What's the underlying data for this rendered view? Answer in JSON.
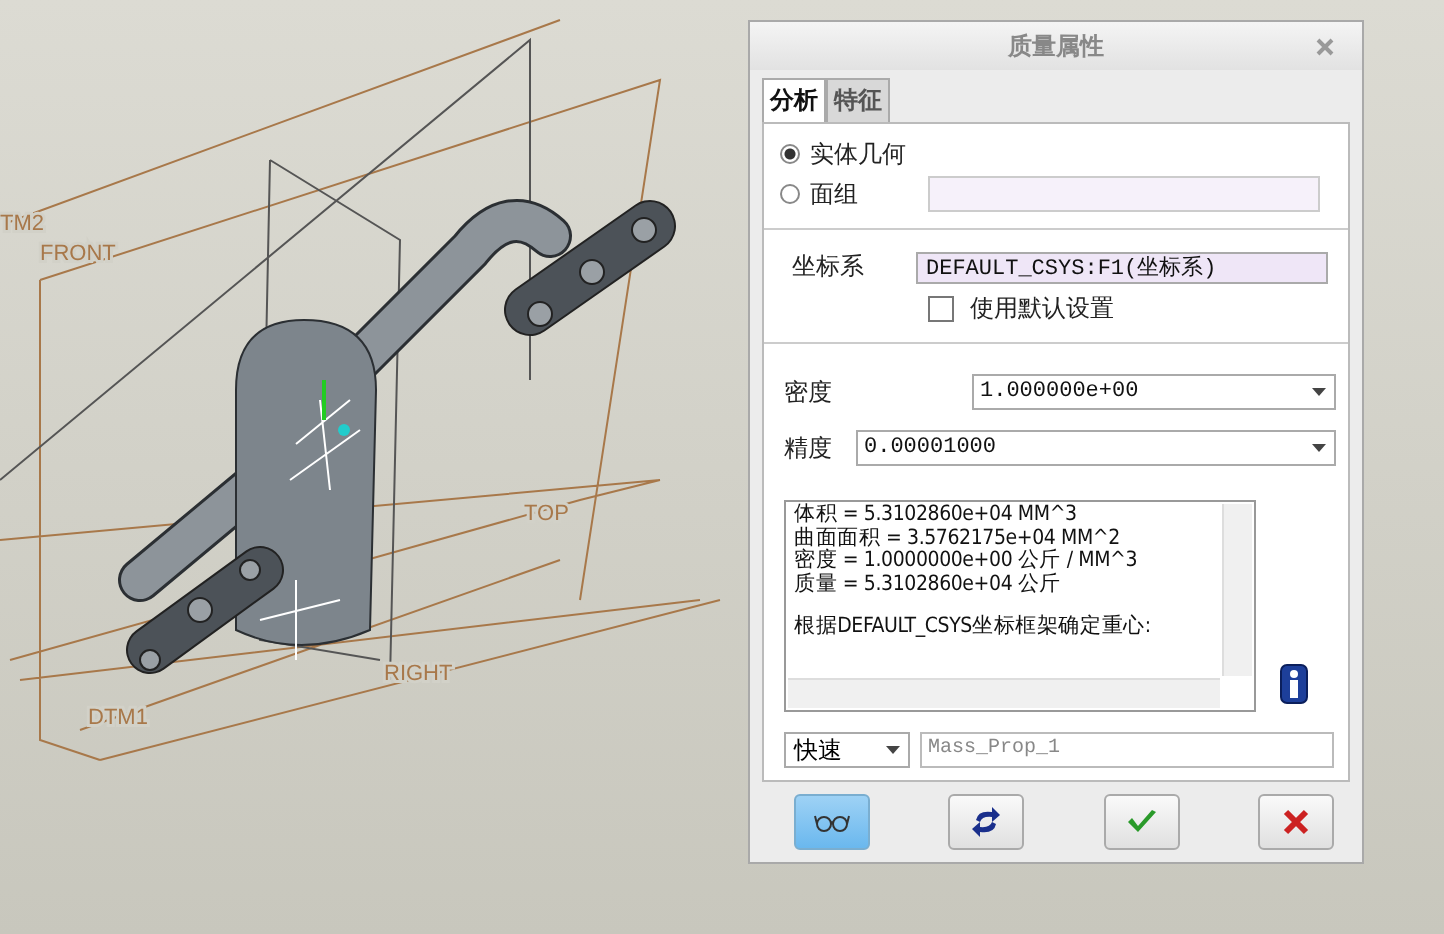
{
  "viewport": {
    "datum_labels": [
      {
        "text": "TM2"
      },
      {
        "text": "FRONT"
      },
      {
        "text": "TOP"
      },
      {
        "text": "RIGHT"
      },
      {
        "text": "DTM1"
      }
    ]
  },
  "dialog": {
    "title": "质量属性",
    "tabs": [
      {
        "label": "分析",
        "selected": true
      },
      {
        "label": "特征",
        "selected": false
      }
    ],
    "geometry_options": [
      {
        "label": "实体几何",
        "selected": true
      },
      {
        "label": "面组",
        "selected": false
      }
    ],
    "csys": {
      "label": "坐标系",
      "value": "DEFAULT_CSYS:F1(坐标系)",
      "default_checkbox": {
        "label": "使用默认设置",
        "checked": false
      }
    },
    "density": {
      "label": "密度",
      "value": "1.000000e+00"
    },
    "accuracy": {
      "label": "精度",
      "value": "0.00001000"
    },
    "results": {
      "blocks": [
        [
          "体积 =  5.3102860e+04  MM^3",
          "曲面面积 =  3.5762175e+04  MM^2",
          "密度 =  1.0000000e+00 公斤 / MM^3",
          "质量 =  5.3102860e+04 公斤"
        ],
        [
          "根据DEFAULT_CSYS坐标框架确定重心:"
        ]
      ]
    },
    "output": {
      "mode": "快速",
      "name": "Mass_Prop_1"
    },
    "buttons": [
      {
        "kind": "preview",
        "pressed": true
      },
      {
        "kind": "repeat",
        "pressed": false
      },
      {
        "kind": "ok",
        "pressed": false
      },
      {
        "kind": "cancel",
        "pressed": false
      }
    ]
  }
}
